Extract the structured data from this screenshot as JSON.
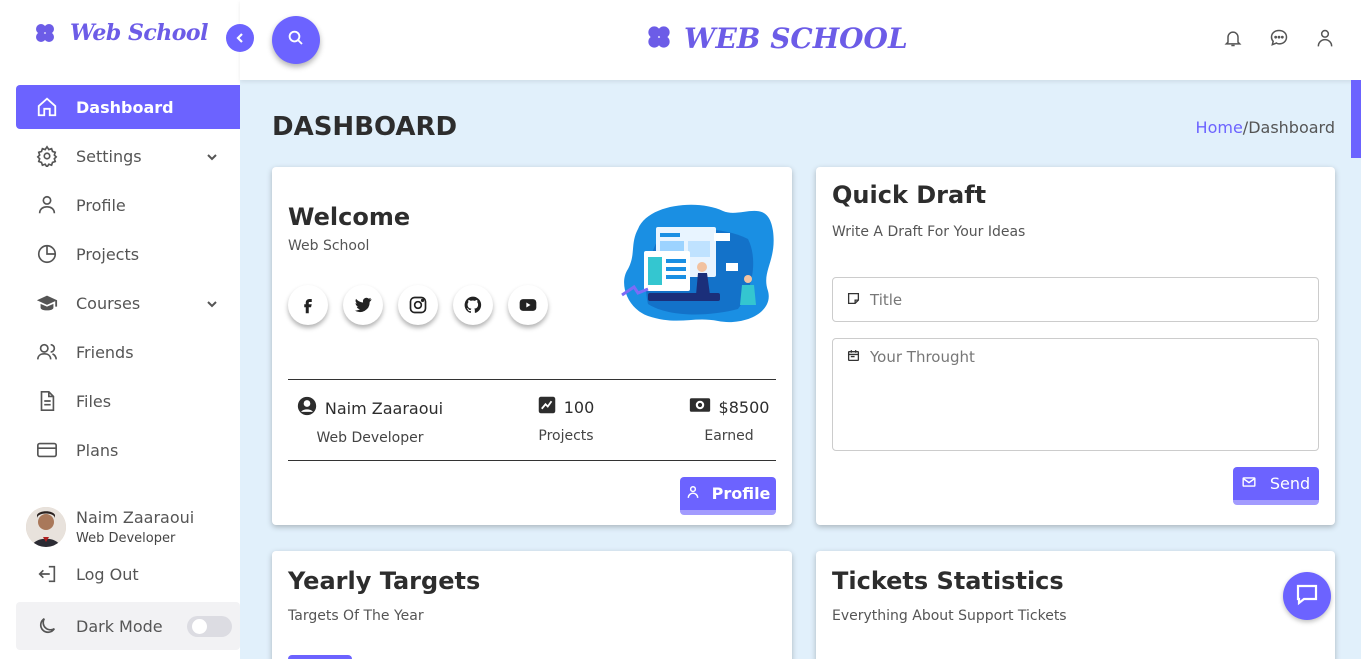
{
  "brand": {
    "name": "Web School",
    "header_title": "WEB SCHOOL",
    "color": "#6c5ce7"
  },
  "accent": "#6c63ff",
  "sidebar": {
    "items": [
      {
        "label": "Dashboard",
        "icon": "home-icon",
        "active": true
      },
      {
        "label": "Settings",
        "icon": "gear-icon",
        "has_dropdown": true
      },
      {
        "label": "Profile",
        "icon": "user-icon"
      },
      {
        "label": "Projects",
        "icon": "pie-chart-icon"
      },
      {
        "label": "Courses",
        "icon": "graduation-cap-icon",
        "has_dropdown": true
      },
      {
        "label": "Friends",
        "icon": "users-icon"
      },
      {
        "label": "Files",
        "icon": "file-icon"
      },
      {
        "label": "Plans",
        "icon": "credit-card-icon"
      }
    ],
    "user": {
      "name": "Naim Zaaraoui",
      "role": "Web Developer"
    },
    "logout_label": "Log Out",
    "dark_mode_label": "Dark Mode",
    "dark_mode_on": false
  },
  "header": {
    "icons": [
      "bell-icon",
      "chat-icon",
      "user-icon"
    ]
  },
  "page": {
    "title": "DASHBOARD",
    "breadcrumb": {
      "home": "Home",
      "sep": "/",
      "current": "Dashboard"
    }
  },
  "welcome": {
    "title": "Welcome",
    "subtitle": "Web School",
    "socials": [
      "facebook-icon",
      "twitter-icon",
      "instagram-icon",
      "github-icon",
      "youtube-icon"
    ],
    "stats": [
      {
        "value": "Naim Zaaraoui",
        "label": "Web Developer",
        "icon": "user-circle-icon"
      },
      {
        "value": "100",
        "label": "Projects",
        "icon": "chart-icon"
      },
      {
        "value": "$8500",
        "label": "Earned",
        "icon": "money-icon"
      }
    ],
    "profile_button": "Profile"
  },
  "draft": {
    "title": "Quick Draft",
    "subtitle": "Write A Draft For Your Ideas",
    "title_placeholder": "Title",
    "thought_placeholder": "Your Throught",
    "send_button": "Send"
  },
  "yearly": {
    "title": "Yearly Targets",
    "subtitle": "Targets Of The Year"
  },
  "tickets": {
    "title": "Tickets Statistics",
    "subtitle": "Everything About Support Tickets"
  }
}
